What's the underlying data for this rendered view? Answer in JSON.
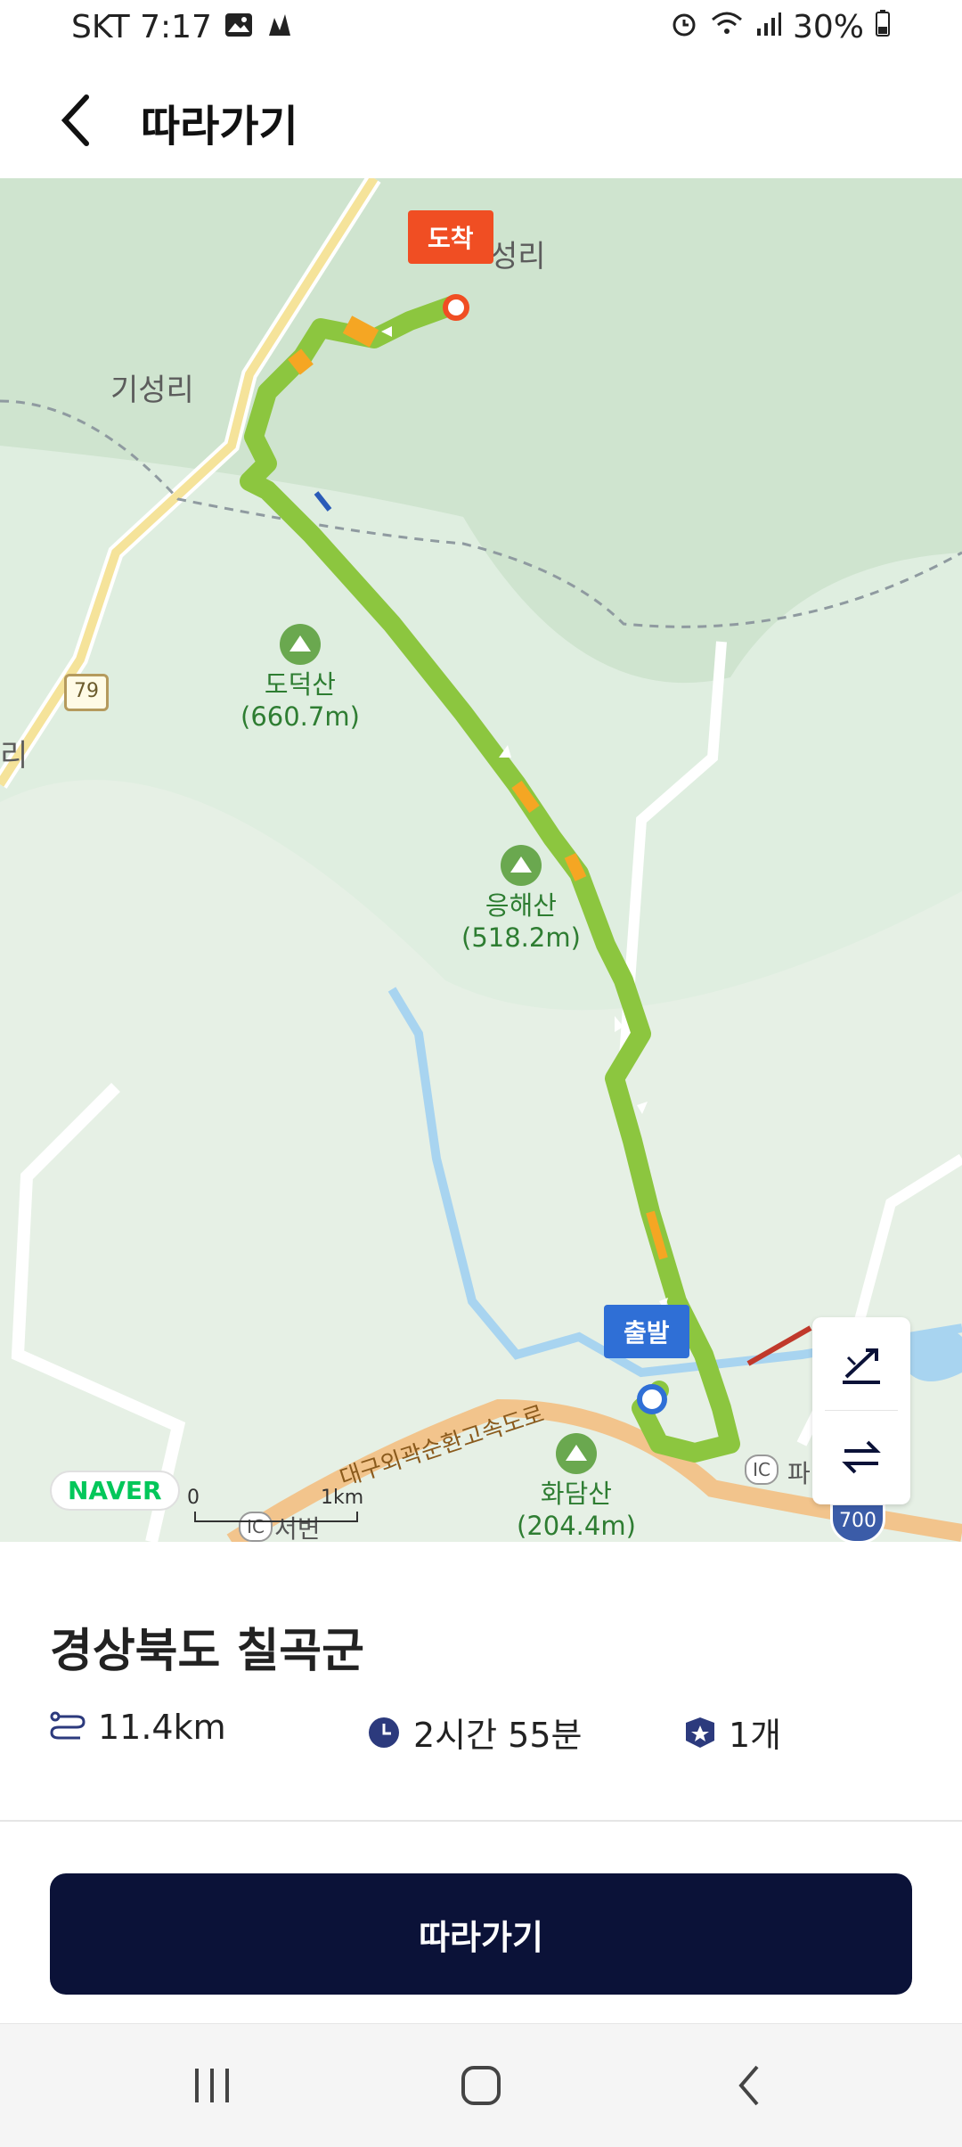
{
  "status": {
    "carrier_time": "SKT 7:17",
    "battery": "30%"
  },
  "header": {
    "title": "따라가기"
  },
  "map": {
    "labels": [
      "기성리",
      "리",
      "성리"
    ],
    "peaks": [
      {
        "name": "도덕산",
        "height": "(660.7m)"
      },
      {
        "name": "응해산",
        "height": "(518.2m)"
      },
      {
        "name": "화담산",
        "height": "(204.4m)"
      }
    ],
    "road_badge": "79",
    "highway_label": "대구외곽순환고속도로",
    "ic_labels": [
      "IC",
      "IC"
    ],
    "town_label": "서변",
    "partial_label": "파",
    "route_badge": "700",
    "end_flag": "도착",
    "start_flag": "출발",
    "naver_logo": "NAVER",
    "scale_zero": "0",
    "scale_km": "1km"
  },
  "sheet": {
    "place": "경상북도 칠곡군",
    "distance": "11.4km",
    "duration": "2시간 55분",
    "count": "1개",
    "follow_button": "따라가기"
  },
  "colors": {
    "route": "#8cc63f",
    "accent": "#0b1238",
    "end": "#f04e23",
    "start": "#2f6fd6"
  }
}
